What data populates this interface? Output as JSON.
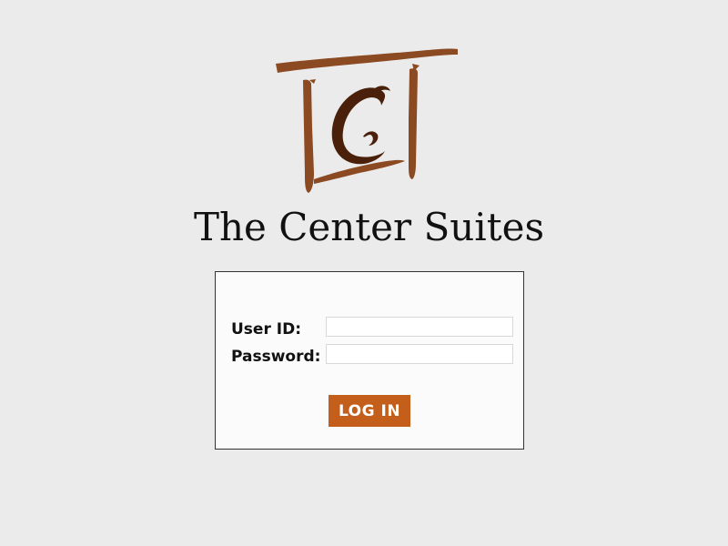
{
  "brand": {
    "name": "The Center Suites",
    "logo_icon": "tcs-brush-logo-icon",
    "logo_colors": {
      "frame": "#8b4a22",
      "letter": "#4a200a"
    }
  },
  "login_form": {
    "user_id_label": "User ID:",
    "user_id_value": "",
    "password_label": "Password:",
    "password_value": "",
    "submit_label": "LOG IN",
    "submit_color": "#c35f1b"
  }
}
